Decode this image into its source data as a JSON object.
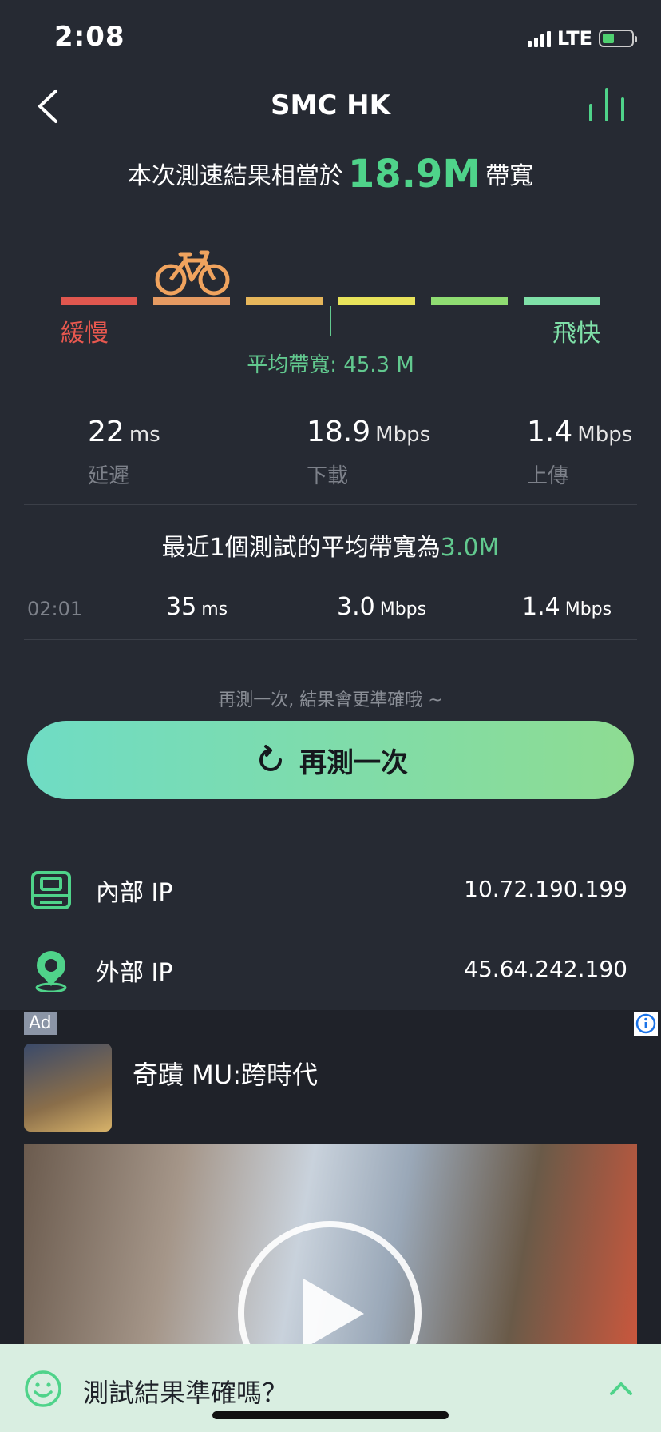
{
  "status_bar": {
    "time": "2:08",
    "network": "LTE",
    "battery_charging": true
  },
  "header": {
    "title": "SMC HK",
    "back_icon": "chevron-left-icon",
    "stats_icon": "bar-chart-icon"
  },
  "headline": {
    "prefix": "本次測速結果相當於",
    "value": "18.9M",
    "suffix": "帶寬"
  },
  "speed_scale": {
    "slow_label": "緩慢",
    "fast_label": "飛快",
    "segments": [
      "#e0574f",
      "#e59a62",
      "#e6b65b",
      "#e8e35b",
      "#8fdc72",
      "#7fe0a8"
    ],
    "indicator_icon": "bicycle-icon",
    "indicator_segment": 2,
    "average_label": "平均帶寬: 45.3 M"
  },
  "metrics": [
    {
      "value": "22",
      "unit": "ms",
      "label": "延遲"
    },
    {
      "value": "18.9",
      "unit": "Mbps",
      "label": "下載"
    },
    {
      "value": "1.4",
      "unit": "Mbps",
      "label": "上傳"
    }
  ],
  "recent": {
    "prefix": "最近1個測試的平均帶寬為",
    "value": "3.0M"
  },
  "history": [
    {
      "time": "02:01",
      "latency": "35",
      "latency_unit": "ms",
      "download": "3.0",
      "download_unit": "Mbps",
      "upload": "1.4",
      "upload_unit": "Mbps"
    }
  ],
  "hint": "再測一次, 結果會更準確哦 ~",
  "retest_button": {
    "label": "再測一次",
    "icon": "refresh-icon",
    "gradient": [
      "#6fdcc4",
      "#8edc92"
    ]
  },
  "ip": {
    "internal": {
      "label": "內部 IP",
      "value": "10.72.190.199",
      "icon": "server-icon"
    },
    "external": {
      "label": "外部 IP",
      "value": "45.64.242.190",
      "icon": "location-pin-icon"
    }
  },
  "ad": {
    "badge": "Ad",
    "title": "奇蹟 MU:跨時代",
    "info_icon": "info-icon",
    "play_icon": "play-icon"
  },
  "feedback": {
    "question": "測試結果準確嗎？",
    "icon": "smile-icon",
    "expand_icon": "chevron-up-icon"
  },
  "colors": {
    "accent": "#4fd38a",
    "background": "#262a33",
    "muted": "#7d818a"
  }
}
